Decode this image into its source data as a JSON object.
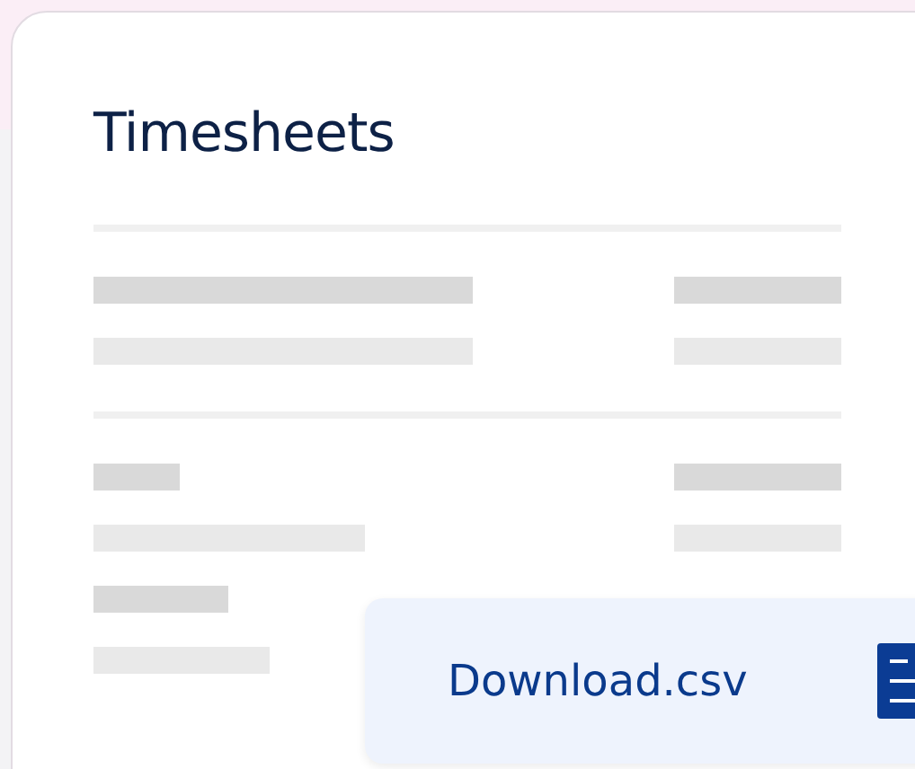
{
  "card": {
    "title": "Timesheets"
  },
  "download_popup": {
    "filename": "Download.csv"
  }
}
